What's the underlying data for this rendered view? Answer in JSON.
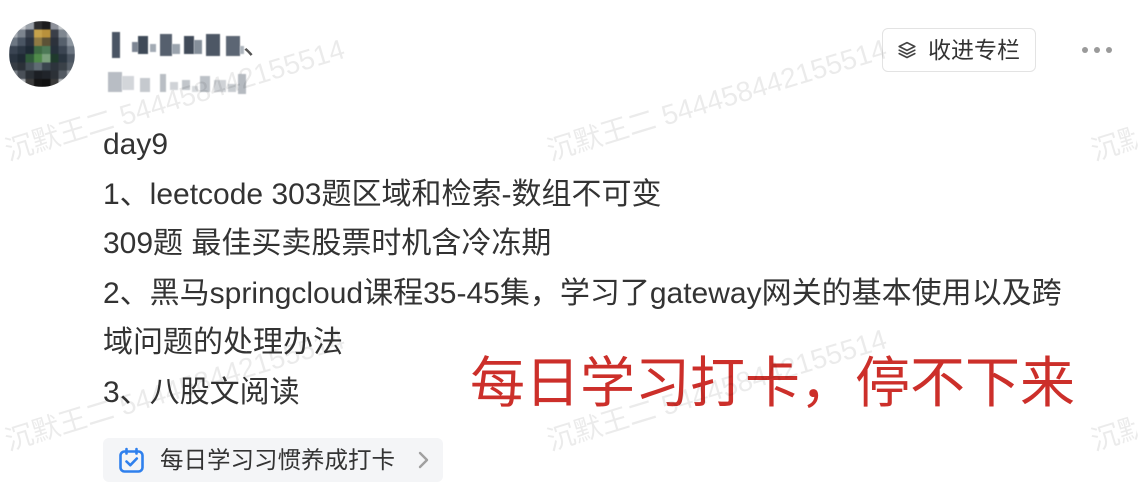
{
  "author": {
    "name_visible_part": "、"
  },
  "actions": {
    "add_to_column_label": "收进专栏",
    "add_to_column_icon": "stack-icon",
    "more_icon": "more-icon"
  },
  "post": {
    "content_lines": [
      "day9",
      "1、leetcode 303题区域和检索-数组不可变",
      "309题 最佳买卖股票时机含冷冻期",
      "2、黑马springcloud课程35-45集，学习了gateway网关的基本使用以及跨",
      "域问题的处理办法",
      "3、八股文阅读"
    ],
    "topic_tag": {
      "label": "每日学习习惯养成打卡",
      "icon": "calendar-check-icon",
      "arrow_icon": "chevron-right-icon"
    }
  },
  "overlay_caption": {
    "text": "每日学习打卡，停不下来"
  },
  "watermark": {
    "text": "沉默王二 544458442155514"
  },
  "colors": {
    "text": "#333333",
    "caption_red": "#cc2f2a",
    "accent_blue": "#2f80ed",
    "tag_bg": "#f4f5f7",
    "border": "#e3e3e3",
    "muted": "#9a9a9a"
  }
}
